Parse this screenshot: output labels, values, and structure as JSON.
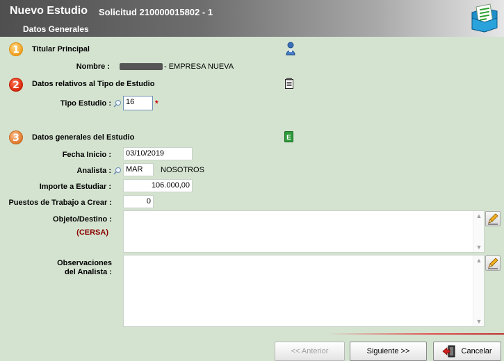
{
  "header": {
    "title": "Nuevo Estudio",
    "subtitle": "Solicitud 210000015802 - 1",
    "tab": "Datos Generales",
    "logo_icon": "folder-document-icon"
  },
  "sections": [
    {
      "number": "1",
      "title": "Titular Principal",
      "icon": "person-icon"
    },
    {
      "number": "2",
      "title": "Datos relativos al Tipo de Estudio",
      "icon": "notepad-icon"
    },
    {
      "number": "3",
      "title": "Datos generales del Estudio",
      "icon": "spreadsheet-icon"
    }
  ],
  "titular": {
    "nombre_label": "Nombre :",
    "nombre_value": "- EMPRESA NUEVA"
  },
  "tipo_estudio": {
    "label": "Tipo Estudio :",
    "value": "16",
    "required_mark": "*"
  },
  "datos": {
    "fecha_label": "Fecha Inicio :",
    "fecha_value": "03/10/2019",
    "analista_label": "Analista :",
    "analista_code": "MAR",
    "analista_name": "NOSOTROS",
    "importe_label": "Importe a Estudiar :",
    "importe_value": "106.000,00",
    "puestos_label": "Puestos de Trabajo a Crear :",
    "puestos_value": "0",
    "objeto_label": "Objeto/Destino :",
    "objeto_note": "(CERSA)",
    "objeto_value": "",
    "obs_label_1": "Observaciones",
    "obs_label_2": "del Analista :",
    "obs_value": ""
  },
  "buttons": {
    "anterior": "<< Anterior",
    "siguiente": "Siguiente >>",
    "cancelar": "Cancelar"
  },
  "colors": {
    "background": "#d4e3d0",
    "required": "#d00000",
    "note": "#8b0000"
  }
}
